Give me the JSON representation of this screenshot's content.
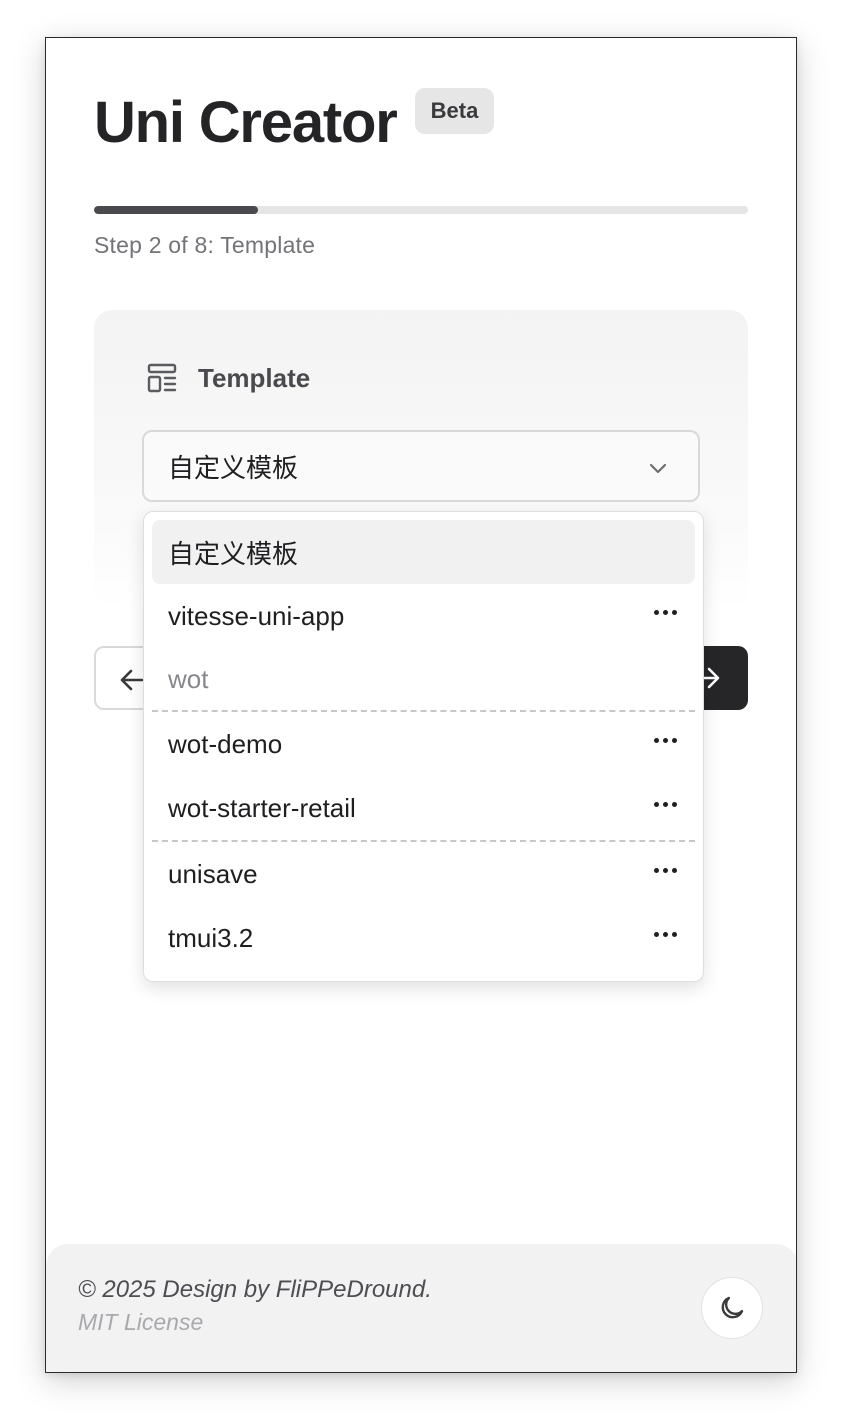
{
  "header": {
    "title": "Uni Creator",
    "badge": "Beta"
  },
  "progress": {
    "current_step": 2,
    "total_steps": 8,
    "fraction": 0.25,
    "label": "Step 2 of 8: Template"
  },
  "template_card": {
    "icon": "template-layout-icon",
    "label": "Template",
    "selected_value": "自定义模板"
  },
  "dropdown": {
    "options": [
      {
        "label": "自定义模板",
        "selected": true,
        "has_more": false
      },
      {
        "label": "vitesse-uni-app",
        "selected": false,
        "has_more": true
      },
      {
        "group_label": "wot"
      },
      {
        "label": "wot-demo",
        "selected": false,
        "has_more": true
      },
      {
        "label": "wot-starter-retail",
        "selected": false,
        "has_more": true
      },
      {
        "label": "unisave",
        "selected": false,
        "has_more": true
      },
      {
        "label": "tmui3.2",
        "selected": false,
        "has_more": true
      }
    ],
    "items": {
      "custom": "自定义模板",
      "vitesse": "vitesse-uni-app",
      "wot_group": "wot",
      "wot_demo": "wot-demo",
      "wot_starter_retail": "wot-starter-retail",
      "unisave": "unisave",
      "tmui": "tmui3.2"
    }
  },
  "navigation": {
    "back_icon": "arrow-left-icon",
    "next_icon": "arrow-right-icon"
  },
  "footer": {
    "copyright": "© 2025 Design by FliPPeDround.",
    "license": "MIT License",
    "theme_icon": "moon-icon"
  },
  "colors": {
    "primary_dark": "#262628",
    "progress_fill": "#4a4a4e",
    "muted_text": "#737378"
  }
}
